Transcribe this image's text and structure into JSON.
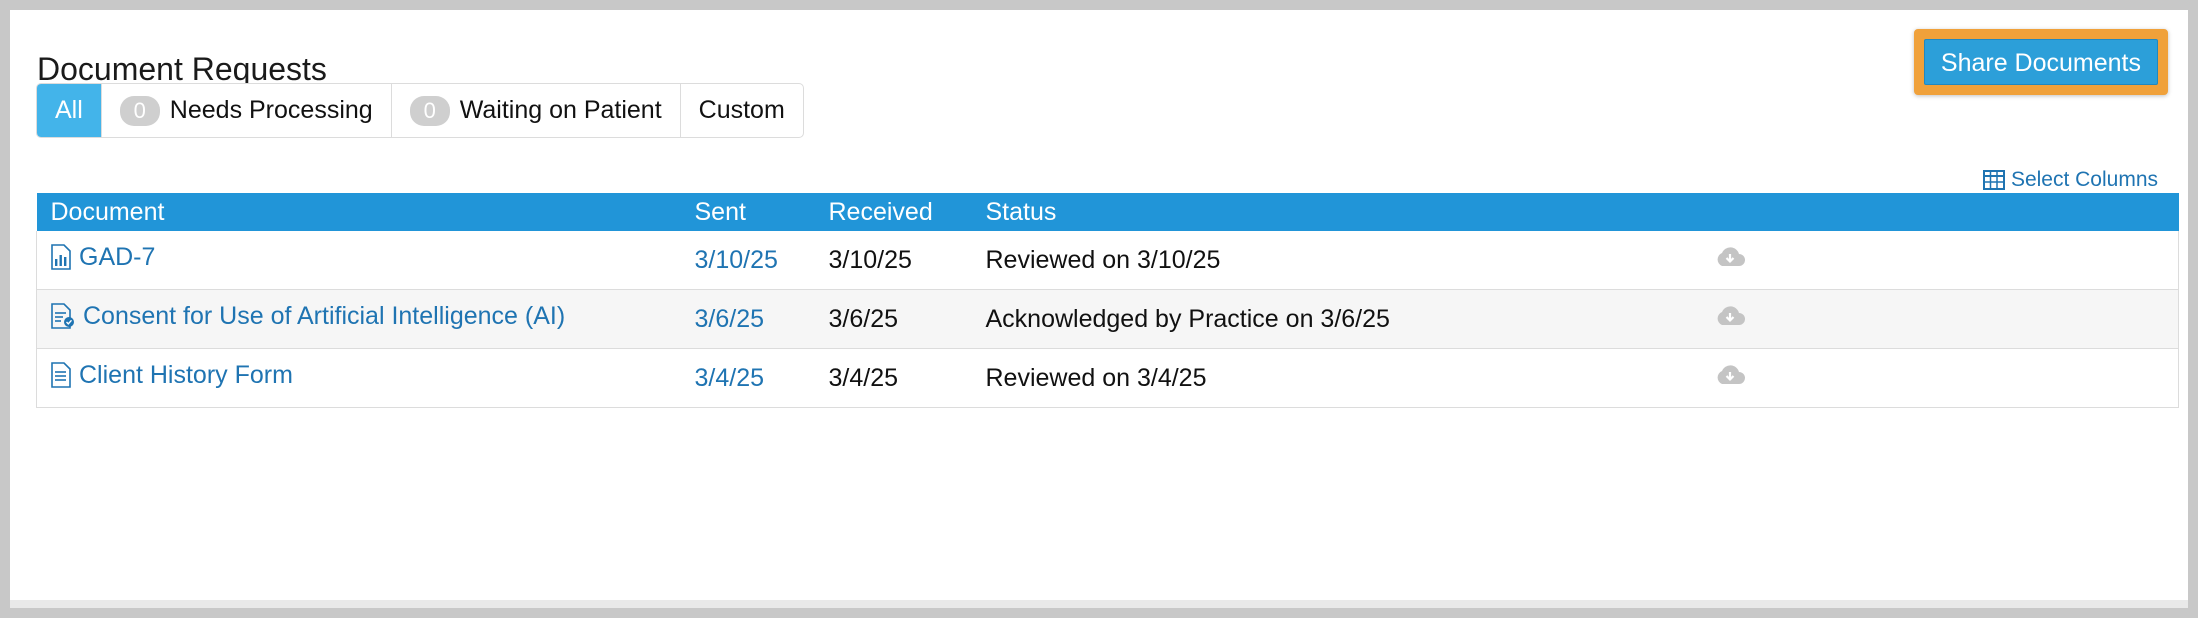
{
  "page": {
    "title": "Document Requests",
    "share_button": "Share Documents"
  },
  "filters": [
    {
      "label": "All",
      "count": null,
      "active": true
    },
    {
      "label": "Needs Processing",
      "count": "0",
      "active": false
    },
    {
      "label": "Waiting on Patient",
      "count": "0",
      "active": false
    },
    {
      "label": "Custom",
      "count": null,
      "active": false
    }
  ],
  "select_columns": {
    "label": "Select Columns",
    "icon": "table-grid-icon"
  },
  "table": {
    "columns": [
      "Document",
      "Sent",
      "Received",
      "Status"
    ],
    "rows": [
      {
        "icon": "chart-document-icon",
        "document": "GAD-7",
        "sent": "3/10/25",
        "received": "3/10/25",
        "status": "Reviewed on 3/10/25"
      },
      {
        "icon": "consent-document-icon",
        "document": "Consent for Use of Artificial Intelligence (AI)",
        "sent": "3/6/25",
        "received": "3/6/25",
        "status": "Acknowledged by Practice on 3/6/25"
      },
      {
        "icon": "form-document-icon",
        "document": "Client History Form",
        "sent": "3/4/25",
        "received": "3/4/25",
        "status": "Reviewed on 3/4/25"
      }
    ]
  },
  "colors": {
    "accent": "#2195d8",
    "active_filter": "#43b4ea",
    "link": "#1f74b2",
    "highlight_border": "#f0a13a"
  }
}
